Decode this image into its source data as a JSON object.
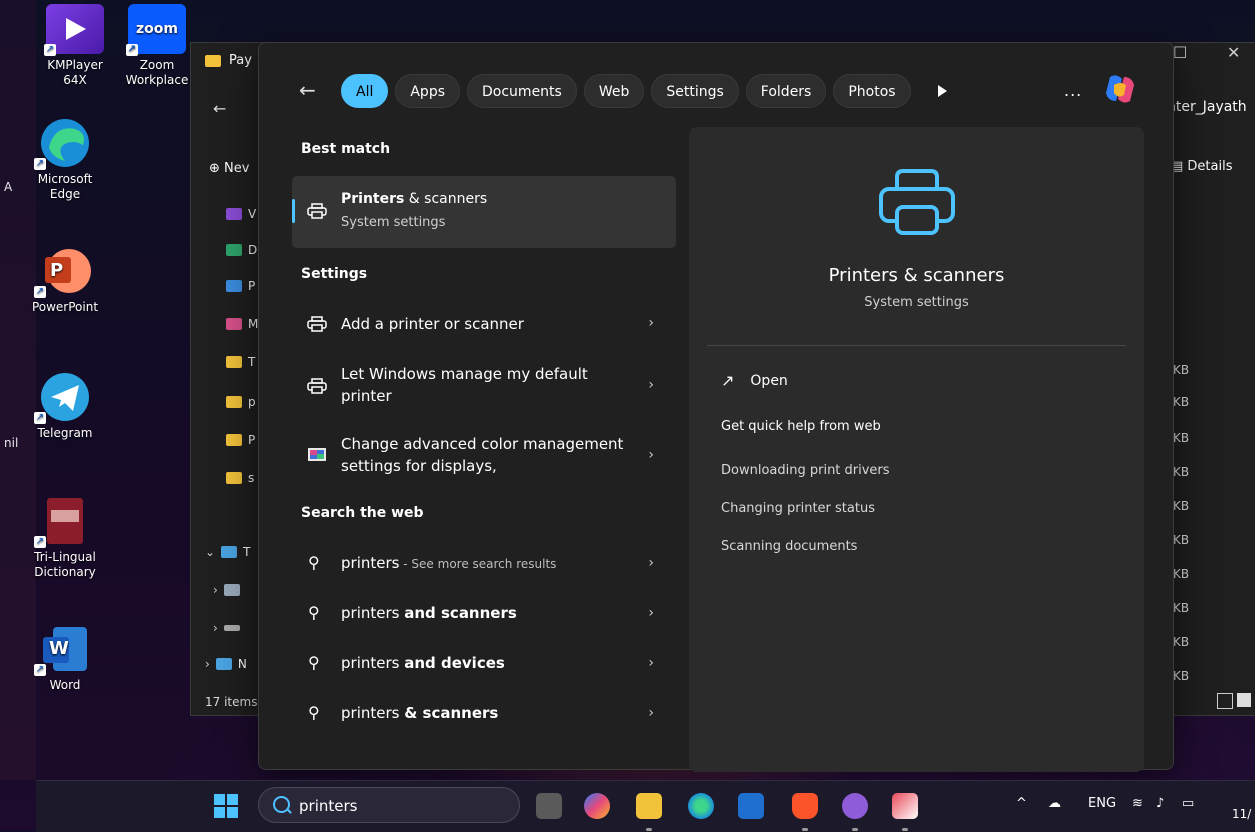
{
  "desktop": {
    "left_fragments": [
      "A",
      "nil"
    ],
    "icons": [
      {
        "name": "kmplayer",
        "label": "KMPlayer 64X"
      },
      {
        "name": "zoom",
        "label": "Zoom Workplace",
        "badge": "zoom"
      },
      {
        "name": "edge",
        "label": "Microsoft Edge"
      },
      {
        "name": "powerpoint",
        "label": "PowerPoint",
        "letter": "P"
      },
      {
        "name": "telegram",
        "label": "Telegram"
      },
      {
        "name": "trilingual",
        "label": "Tri-Lingual Dictionary"
      },
      {
        "name": "word",
        "label": "Word",
        "letter": "W"
      }
    ]
  },
  "explorer": {
    "title": "Pay",
    "address_fragment": "nter_Jayath",
    "new_label": "Nev",
    "details_label": "Details",
    "items_count": "17 items",
    "left_items": [
      "V",
      "D",
      "P",
      "M",
      "T",
      "p",
      "P",
      "s"
    ],
    "tree_items": [
      "T",
      "",
      "",
      "N"
    ],
    "size_fragments": [
      "KB",
      "KB",
      "KB",
      "KB",
      "KB",
      "KB",
      "KB",
      "KB",
      "KB",
      "KB"
    ]
  },
  "search": {
    "filters": [
      "All",
      "Apps",
      "Documents",
      "Web",
      "Settings",
      "Folders",
      "Photos"
    ],
    "more_label": "...",
    "best_match_header": "Best match",
    "best_match": {
      "title_bold": "Printers",
      "title_rest": " & scanners",
      "subtitle": "System settings"
    },
    "settings_header": "Settings",
    "settings_items": [
      {
        "label": "Add a printer or scanner"
      },
      {
        "label": "Let Windows manage my default printer"
      },
      {
        "label": "Change advanced color management settings for displays,"
      }
    ],
    "web_header": "Search the web",
    "web_items": [
      {
        "prefix": "printers",
        "rest": "",
        "sub": " - See more search results"
      },
      {
        "prefix": "printers ",
        "rest": "and scanners",
        "sub": ""
      },
      {
        "prefix": "printers ",
        "rest": "and devices",
        "sub": ""
      },
      {
        "prefix": "printers ",
        "rest": "& scanners",
        "sub": ""
      }
    ],
    "preview": {
      "title": "Printers & scanners",
      "subtitle": "System settings",
      "open_label": "Open",
      "quick_help": "Get quick help from web",
      "links": [
        "Downloading print drivers",
        "Changing printer status",
        "Scanning documents"
      ]
    }
  },
  "taskbar": {
    "search_value": "printers",
    "tray": {
      "chevron": "^",
      "language": "ENG",
      "date_fragment": "11/"
    }
  },
  "colors": {
    "accent": "#4cc2ff",
    "panel": "#202020",
    "preview": "#2b2b2b"
  }
}
